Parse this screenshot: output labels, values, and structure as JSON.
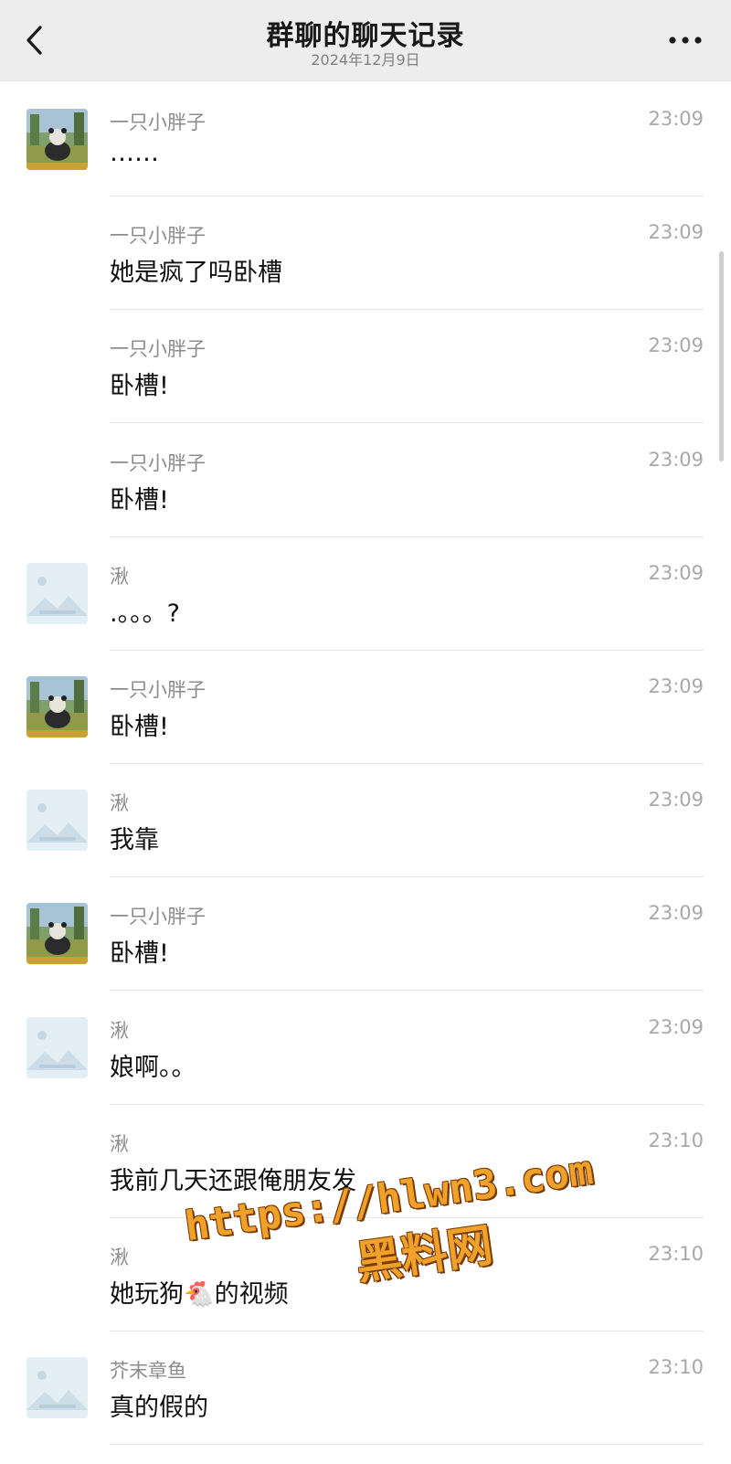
{
  "header": {
    "title": "群聊的聊天记录",
    "date": "2024年12月9日"
  },
  "messages": [
    {
      "sender": "一只小胖子",
      "time": "23:09",
      "text": "……",
      "avatar": "panda-photo"
    },
    {
      "sender": "一只小胖子",
      "time": "23:09",
      "text": "她是疯了吗卧槽",
      "avatar": ""
    },
    {
      "sender": "一只小胖子",
      "time": "23:09",
      "text": "卧槽!",
      "avatar": ""
    },
    {
      "sender": "一只小胖子",
      "time": "23:09",
      "text": "卧槽!",
      "avatar": ""
    },
    {
      "sender": "湫",
      "time": "23:09",
      "text": ".。。。?",
      "avatar": "placeholder-image"
    },
    {
      "sender": "一只小胖子",
      "time": "23:09",
      "text": "卧槽!",
      "avatar": "panda-photo"
    },
    {
      "sender": "湫",
      "time": "23:09",
      "text": "我靠",
      "avatar": "placeholder-image"
    },
    {
      "sender": "一只小胖子",
      "time": "23:09",
      "text": "卧槽!",
      "avatar": "panda-photo"
    },
    {
      "sender": "湫",
      "time": "23:09",
      "text": "娘啊。。",
      "avatar": "placeholder-image"
    },
    {
      "sender": "湫",
      "time": "23:10",
      "text": "我前几天还跟俺朋友发",
      "avatar": ""
    },
    {
      "sender": "湫",
      "time": "23:10",
      "text": "她玩狗🐔的视频",
      "avatar": ""
    },
    {
      "sender": "芥末章鱼",
      "time": "23:10",
      "text": "真的假的",
      "avatar": "placeholder-image"
    }
  ],
  "watermark": {
    "url": "https://hlwn3.com",
    "name": "黑料网"
  },
  "icons": {
    "back": "chevron-left-icon",
    "more": "more-dots-icon"
  }
}
